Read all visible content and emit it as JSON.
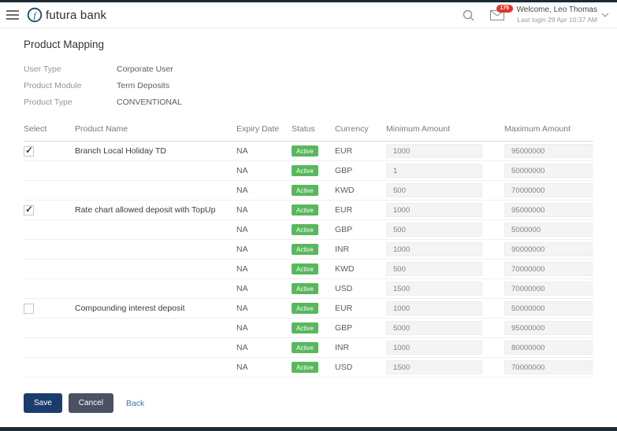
{
  "header": {
    "brand": "futura bank",
    "mail_badge": "175",
    "welcome": "Welcome, Leo Thomas",
    "last_login": "Last login 29 Apr 10:37 AM"
  },
  "page": {
    "title": "Product Mapping"
  },
  "info": {
    "fields": [
      {
        "label": "User Type",
        "value": "Corporate User"
      },
      {
        "label": "Product Module",
        "value": "Term Deposits"
      },
      {
        "label": "Product Type",
        "value": "CONVENTIONAL"
      }
    ]
  },
  "table": {
    "columns": [
      "Select",
      "Product Name",
      "Expiry Date",
      "Status",
      "Currency",
      "Minimum Amount",
      "Maximum Amount"
    ],
    "rows": [
      {
        "group_start": true,
        "selected": true,
        "product": "Branch Local Holiday TD",
        "expiry_date": "NA",
        "status": "Active",
        "currency": "EUR",
        "minimum_amount": "1000",
        "maximum_amount": "95000000"
      },
      {
        "expiry_date": "NA",
        "status": "Active",
        "currency": "GBP",
        "minimum_amount": "1",
        "maximum_amount": "50000000"
      },
      {
        "expiry_date": "NA",
        "status": "Active",
        "currency": "KWD",
        "minimum_amount": "500",
        "maximum_amount": "70000000"
      },
      {
        "group_start": true,
        "selected": true,
        "product": "Rate chart allowed deposit with TopUp",
        "expiry_date": "NA",
        "status": "Active",
        "currency": "EUR",
        "minimum_amount": "1000",
        "maximum_amount": "95000000"
      },
      {
        "expiry_date": "NA",
        "status": "Active",
        "currency": "GBP",
        "minimum_amount": "500",
        "maximum_amount": "5000000"
      },
      {
        "expiry_date": "NA",
        "status": "Active",
        "currency": "INR",
        "minimum_amount": "1000",
        "maximum_amount": "90000000"
      },
      {
        "expiry_date": "NA",
        "status": "Active",
        "currency": "KWD",
        "minimum_amount": "500",
        "maximum_amount": "70000000"
      },
      {
        "expiry_date": "NA",
        "status": "Active",
        "currency": "USD",
        "minimum_amount": "1500",
        "maximum_amount": "70000000"
      },
      {
        "group_start": true,
        "selected": false,
        "product": "Compounding interest deposit",
        "expiry_date": "NA",
        "status": "Active",
        "currency": "EUR",
        "minimum_amount": "1000",
        "maximum_amount": "50000000"
      },
      {
        "expiry_date": "NA",
        "status": "Active",
        "currency": "GBP",
        "minimum_amount": "5000",
        "maximum_amount": "95000000"
      },
      {
        "expiry_date": "NA",
        "status": "Active",
        "currency": "INR",
        "minimum_amount": "1000",
        "maximum_amount": "80000000"
      },
      {
        "expiry_date": "NA",
        "status": "Active",
        "currency": "USD",
        "minimum_amount": "1500",
        "maximum_amount": "70000000"
      }
    ]
  },
  "actions": {
    "save": "Save",
    "cancel": "Cancel",
    "back": "Back"
  },
  "colors": {
    "active_badge": "#58b85c",
    "save_button": "#1b3d6e",
    "cancel_button": "#4a5264",
    "mail_badge": "#e2342b",
    "link": "#3779b8",
    "brand_accent": "#124d68"
  }
}
